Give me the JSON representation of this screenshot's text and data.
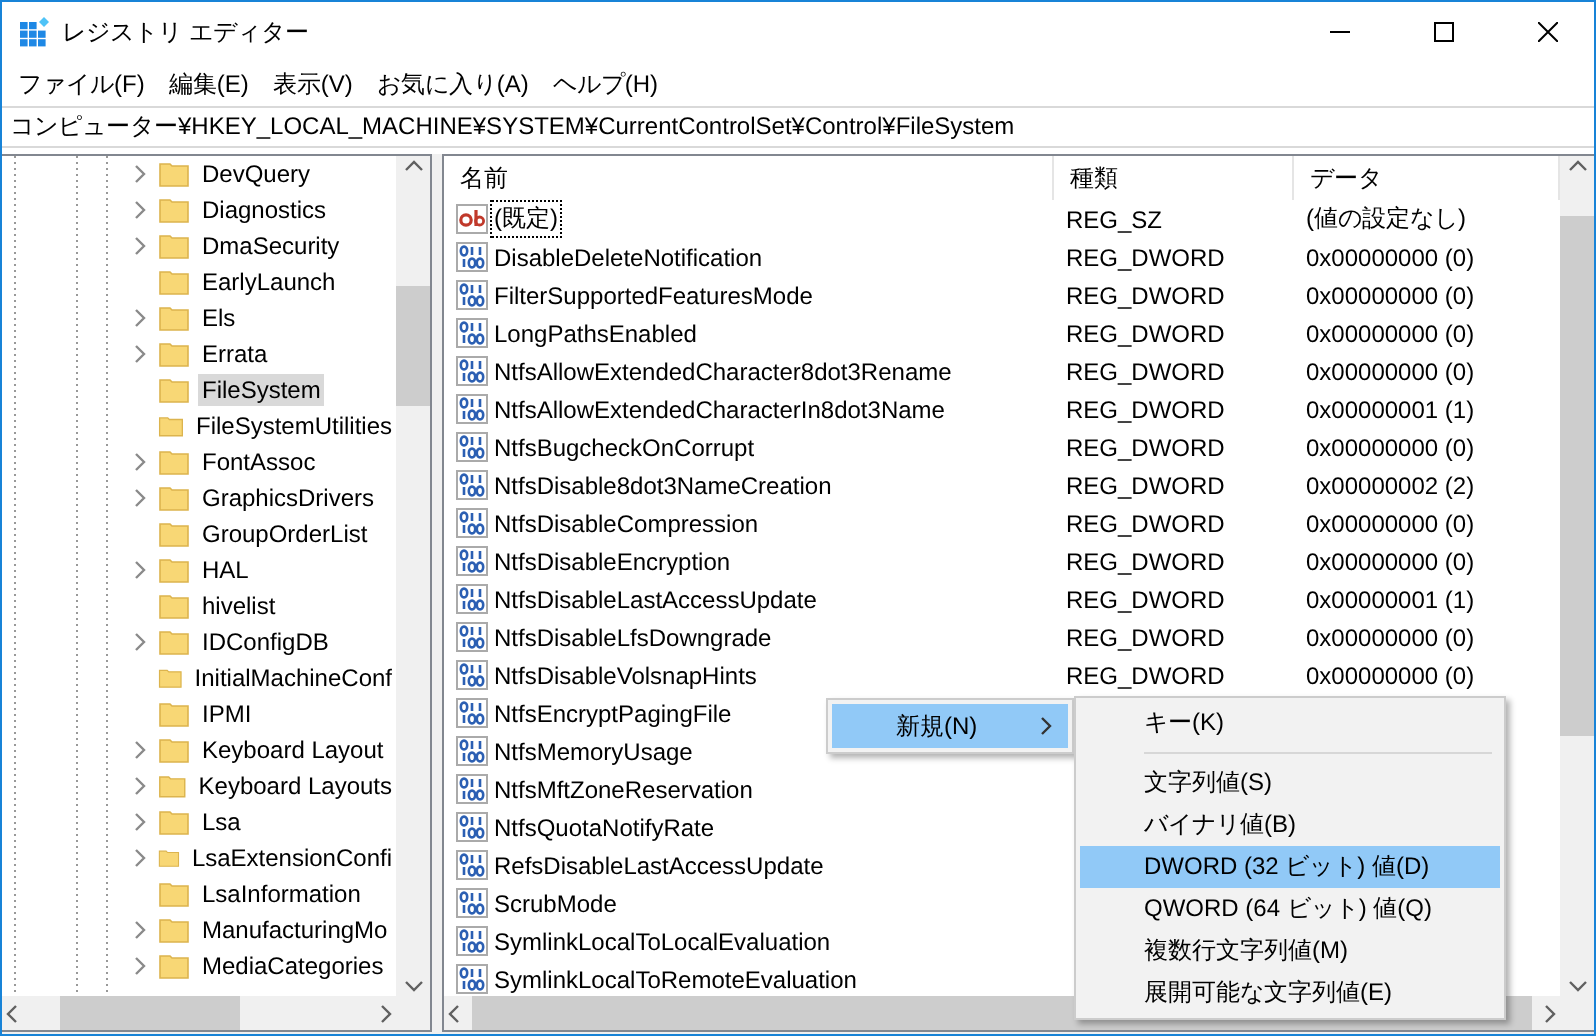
{
  "window": {
    "title": "レジストリ エディター"
  },
  "menu_bar": [
    "ファイル(F)",
    "編集(E)",
    "表示(V)",
    "お気に入り(A)",
    "ヘルプ(H)"
  ],
  "address_bar": {
    "value": "コンピューター¥HKEY_LOCAL_MACHINE¥SYSTEM¥CurrentControlSet¥Control¥FileSystem"
  },
  "tree": {
    "items": [
      {
        "label": "DevQuery",
        "expandable": true,
        "selected": false
      },
      {
        "label": "Diagnostics",
        "expandable": true,
        "selected": false
      },
      {
        "label": "DmaSecurity",
        "expandable": true,
        "selected": false
      },
      {
        "label": "EarlyLaunch",
        "expandable": false,
        "selected": false
      },
      {
        "label": "Els",
        "expandable": true,
        "selected": false
      },
      {
        "label": "Errata",
        "expandable": true,
        "selected": false
      },
      {
        "label": "FileSystem",
        "expandable": false,
        "selected": true
      },
      {
        "label": "FileSystemUtilities",
        "expandable": false,
        "selected": false
      },
      {
        "label": "FontAssoc",
        "expandable": true,
        "selected": false
      },
      {
        "label": "GraphicsDrivers",
        "expandable": true,
        "selected": false
      },
      {
        "label": "GroupOrderList",
        "expandable": false,
        "selected": false
      },
      {
        "label": "HAL",
        "expandable": true,
        "selected": false
      },
      {
        "label": "hivelist",
        "expandable": false,
        "selected": false
      },
      {
        "label": "IDConfigDB",
        "expandable": true,
        "selected": false
      },
      {
        "label": "InitialMachineConf",
        "expandable": false,
        "selected": false
      },
      {
        "label": "IPMI",
        "expandable": false,
        "selected": false
      },
      {
        "label": "Keyboard Layout",
        "expandable": true,
        "selected": false
      },
      {
        "label": "Keyboard Layouts",
        "expandable": true,
        "selected": false
      },
      {
        "label": "Lsa",
        "expandable": true,
        "selected": false
      },
      {
        "label": "LsaExtensionConfi",
        "expandable": true,
        "selected": false
      },
      {
        "label": "LsaInformation",
        "expandable": false,
        "selected": false
      },
      {
        "label": "ManufacturingMo",
        "expandable": true,
        "selected": false
      },
      {
        "label": "MediaCategories",
        "expandable": true,
        "selected": false
      }
    ]
  },
  "list": {
    "columns": [
      "名前",
      "種類",
      "データ"
    ],
    "rows": [
      {
        "kind": "string",
        "name": "(既定)",
        "type": "REG_SZ",
        "data": "(値の設定なし)",
        "focused": true
      },
      {
        "kind": "dword",
        "name": "DisableDeleteNotification",
        "type": "REG_DWORD",
        "data": "0x00000000 (0)",
        "focused": false
      },
      {
        "kind": "dword",
        "name": "FilterSupportedFeaturesMode",
        "type": "REG_DWORD",
        "data": "0x00000000 (0)",
        "focused": false
      },
      {
        "kind": "dword",
        "name": "LongPathsEnabled",
        "type": "REG_DWORD",
        "data": "0x00000000 (0)",
        "focused": false
      },
      {
        "kind": "dword",
        "name": "NtfsAllowExtendedCharacter8dot3Rename",
        "type": "REG_DWORD",
        "data": "0x00000000 (0)",
        "focused": false
      },
      {
        "kind": "dword",
        "name": "NtfsAllowExtendedCharacterIn8dot3Name",
        "type": "REG_DWORD",
        "data": "0x00000001 (1)",
        "focused": false
      },
      {
        "kind": "dword",
        "name": "NtfsBugcheckOnCorrupt",
        "type": "REG_DWORD",
        "data": "0x00000000 (0)",
        "focused": false
      },
      {
        "kind": "dword",
        "name": "NtfsDisable8dot3NameCreation",
        "type": "REG_DWORD",
        "data": "0x00000002 (2)",
        "focused": false
      },
      {
        "kind": "dword",
        "name": "NtfsDisableCompression",
        "type": "REG_DWORD",
        "data": "0x00000000 (0)",
        "focused": false
      },
      {
        "kind": "dword",
        "name": "NtfsDisableEncryption",
        "type": "REG_DWORD",
        "data": "0x00000000 (0)",
        "focused": false
      },
      {
        "kind": "dword",
        "name": "NtfsDisableLastAccessUpdate",
        "type": "REG_DWORD",
        "data": "0x00000001 (1)",
        "focused": false
      },
      {
        "kind": "dword",
        "name": "NtfsDisableLfsDowngrade",
        "type": "REG_DWORD",
        "data": "0x00000000 (0)",
        "focused": false
      },
      {
        "kind": "dword",
        "name": "NtfsDisableVolsnapHints",
        "type": "REG_DWORD",
        "data": "0x00000000 (0)",
        "focused": false
      },
      {
        "kind": "dword",
        "name": "NtfsEncryptPagingFile",
        "focused": false
      },
      {
        "kind": "dword",
        "name": "NtfsMemoryUsage",
        "focused": false
      },
      {
        "kind": "dword",
        "name": "NtfsMftZoneReservation",
        "focused": false
      },
      {
        "kind": "dword",
        "name": "NtfsQuotaNotifyRate",
        "focused": false
      },
      {
        "kind": "dword",
        "name": "RefsDisableLastAccessUpdate",
        "focused": false
      },
      {
        "kind": "dword",
        "name": "ScrubMode",
        "focused": false
      },
      {
        "kind": "dword",
        "name": "SymlinkLocalToLocalEvaluation",
        "focused": false
      },
      {
        "kind": "dword",
        "name": "SymlinkLocalToRemoteEvaluation",
        "focused": false
      }
    ]
  },
  "context_menu": {
    "items": [
      {
        "label": "新規(N)",
        "has_submenu": true,
        "selected": true
      }
    ]
  },
  "submenu": {
    "items": [
      {
        "kind": "item",
        "label": "キー(K)",
        "selected": false
      },
      {
        "kind": "separator"
      },
      {
        "kind": "item",
        "label": "文字列値(S)",
        "selected": false
      },
      {
        "kind": "item",
        "label": "バイナリ値(B)",
        "selected": false
      },
      {
        "kind": "item",
        "label": "DWORD (32 ビット) 値(D)",
        "selected": true
      },
      {
        "kind": "item",
        "label": "QWORD (64 ビット) 値(Q)",
        "selected": false
      },
      {
        "kind": "item",
        "label": "複数行文字列値(M)",
        "selected": false
      },
      {
        "kind": "item",
        "label": "展開可能な文字列値(E)",
        "selected": false
      }
    ]
  }
}
